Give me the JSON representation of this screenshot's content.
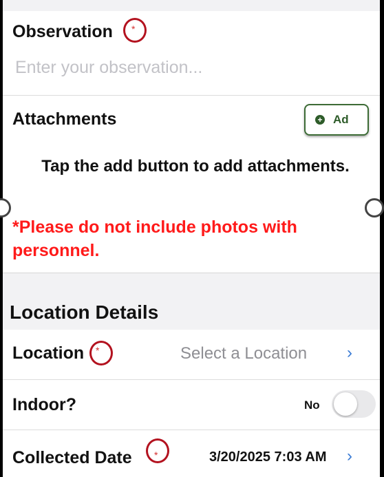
{
  "observation": {
    "label": "Observation",
    "required_mark": "*",
    "placeholder": "Enter your observation..."
  },
  "attachments": {
    "label": "Attachments",
    "add_button_label": "Ad",
    "add_icon": "plus-circle-icon",
    "hint": "Tap the add button to add attachments.",
    "warning": "*Please do not include photos with personnel."
  },
  "location_details": {
    "section_title": "Location Details",
    "location": {
      "label": "Location",
      "required_mark": "*",
      "value": "Select a Location",
      "chevron": "›"
    },
    "indoor": {
      "label": "Indoor?",
      "state_label": "No"
    },
    "collected_date": {
      "label": "Collected Date",
      "required_mark": "*",
      "value": "3/20/2025 7:03 AM",
      "chevron": "›"
    }
  },
  "colors": {
    "required": "#d32f2f",
    "warning": "#ff1a1a",
    "accent": "#3a7bd5",
    "button": "#2e5c2a",
    "annotation_circle": "#b3121f"
  }
}
